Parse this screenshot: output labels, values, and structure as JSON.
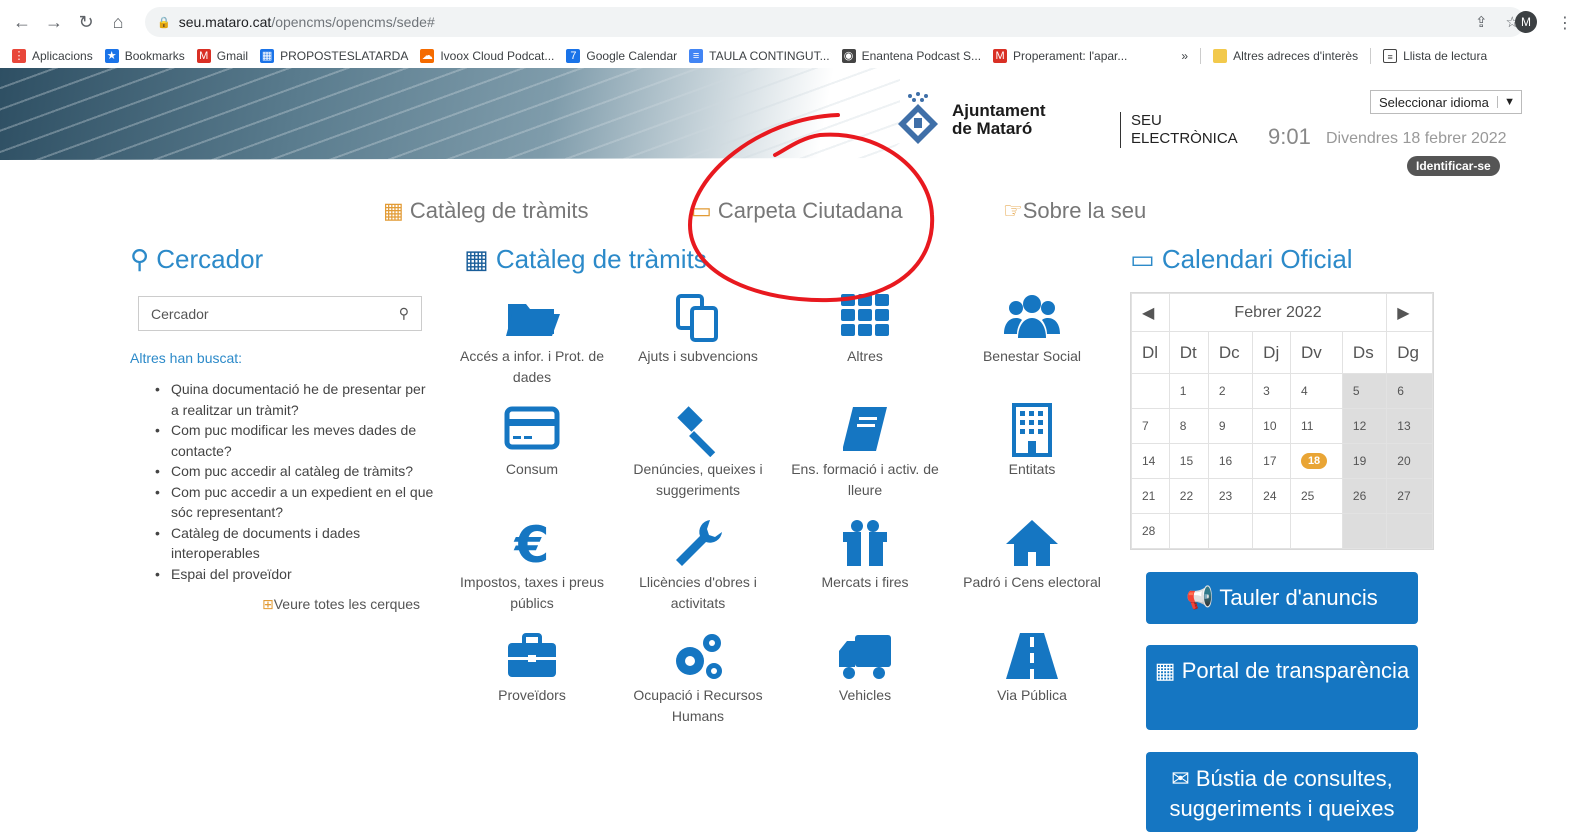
{
  "browser": {
    "url_host": "seu.mataro.cat",
    "url_path": "/opencms/opencms/sede#",
    "profile_initial": "M",
    "bookmarks": [
      {
        "label": "Aplicacions",
        "color": "#e8473a",
        "glyph": "⋮"
      },
      {
        "label": "Bookmarks",
        "color": "#1a73e8",
        "glyph": "★"
      },
      {
        "label": "Gmail",
        "color": "#d93025",
        "glyph": "M"
      },
      {
        "label": "PROPOSTESLATARDA",
        "color": "#1a73e8",
        "glyph": "▦"
      },
      {
        "label": "Ivoox Cloud Podcat...",
        "color": "#f56b00",
        "glyph": "☁"
      },
      {
        "label": "Google Calendar",
        "color": "#1a73e8",
        "glyph": "7"
      },
      {
        "label": "TAULA CONTINGUT...",
        "color": "#4285f4",
        "glyph": "≡"
      },
      {
        "label": "Enantena Podcast S...",
        "color": "#444",
        "glyph": "◉"
      },
      {
        "label": "Properament: l'apar...",
        "color": "#d93025",
        "glyph": "M"
      }
    ],
    "bookmarks_more": "»",
    "other_bookmarks": "Altres adreces d'interès",
    "reading_list": "Llista de lectura"
  },
  "header": {
    "logo_line1": "Ajuntament",
    "logo_line2": "de Mataró",
    "seu_line1": "SEU",
    "seu_line2": "ELECTRÒNICA",
    "time": "9:01",
    "date": "Divendres 18 febrer 2022",
    "language_select": "Seleccionar idioma",
    "login": "Identificar-se"
  },
  "topnav": [
    {
      "label": "Catàleg de tràmits",
      "icon": "grid-icon"
    },
    {
      "label": "Carpeta Ciutadana",
      "icon": "folder-icon"
    },
    {
      "label": "Sobre la seu",
      "icon": "hand-pointer-icon"
    }
  ],
  "search": {
    "title": "Cercador",
    "placeholder": "Cercador",
    "others_title": "Altres han buscat:",
    "items": [
      "Quina documentació he de presentar per a realitzar un tràmit?",
      "Com puc modificar les meves dades de contacte?",
      "Com puc accedir al catàleg de tràmits?",
      "Com puc accedir a un expedient en el que sóc representant?",
      "Catàleg de documents i dades interoperables",
      "Espai del proveïdor"
    ],
    "see_all": "Veure totes les cerques"
  },
  "catalog": {
    "title": "Catàleg de tràmits",
    "tiles": [
      {
        "label": "Accés a infor. i Prot. de dades",
        "icon": "folder-open-icon"
      },
      {
        "label": "Ajuts i subvencions",
        "icon": "copy-icon"
      },
      {
        "label": "Altres",
        "icon": "th-grid-icon"
      },
      {
        "label": "Benestar Social",
        "icon": "users-icon"
      },
      {
        "label": "Consum",
        "icon": "credit-card-icon"
      },
      {
        "label": "Denúncies, queixes i suggeriments",
        "icon": "gavel-icon"
      },
      {
        "label": "Ens. formació i activ. de lleure",
        "icon": "book-icon"
      },
      {
        "label": "Entitats",
        "icon": "building-icon"
      },
      {
        "label": "Impostos, taxes i preus públics",
        "icon": "euro-icon"
      },
      {
        "label": "Llicències d'obres i activitats",
        "icon": "wrench-icon"
      },
      {
        "label": "Mercats i fires",
        "icon": "gift-icon"
      },
      {
        "label": "Padró i Cens electoral",
        "icon": "home-icon"
      },
      {
        "label": "Proveïdors",
        "icon": "briefcase-icon"
      },
      {
        "label": "Ocupació i Recursos Humans",
        "icon": "cogs-icon"
      },
      {
        "label": "Vehicles",
        "icon": "truck-icon"
      },
      {
        "label": "Via Pública",
        "icon": "road-icon"
      }
    ]
  },
  "calendar": {
    "title": "Calendari Oficial",
    "month": "Febrer 2022",
    "weekdays": [
      "Dl",
      "Dt",
      "Dc",
      "Dj",
      "Dv",
      "Ds",
      "Dg"
    ],
    "weeks": [
      [
        "",
        "1",
        "2",
        "3",
        "4",
        "5",
        "6"
      ],
      [
        "7",
        "8",
        "9",
        "10",
        "11",
        "12",
        "13"
      ],
      [
        "14",
        "15",
        "16",
        "17",
        "18",
        "19",
        "20"
      ],
      [
        "21",
        "22",
        "23",
        "24",
        "25",
        "26",
        "27"
      ],
      [
        "28",
        "",
        "",
        "",
        "",
        "",
        ""
      ]
    ],
    "today": "18"
  },
  "buttons": {
    "board": "Tauler d'anuncis",
    "transparency": "Portal de transparència",
    "mailbox": "Bústia de consultes, suggeriments i queixes"
  },
  "colors": {
    "accent": "#1576c2",
    "link": "#2c8ac9",
    "orange": "#e29b35",
    "annotation": "#e8191f"
  }
}
